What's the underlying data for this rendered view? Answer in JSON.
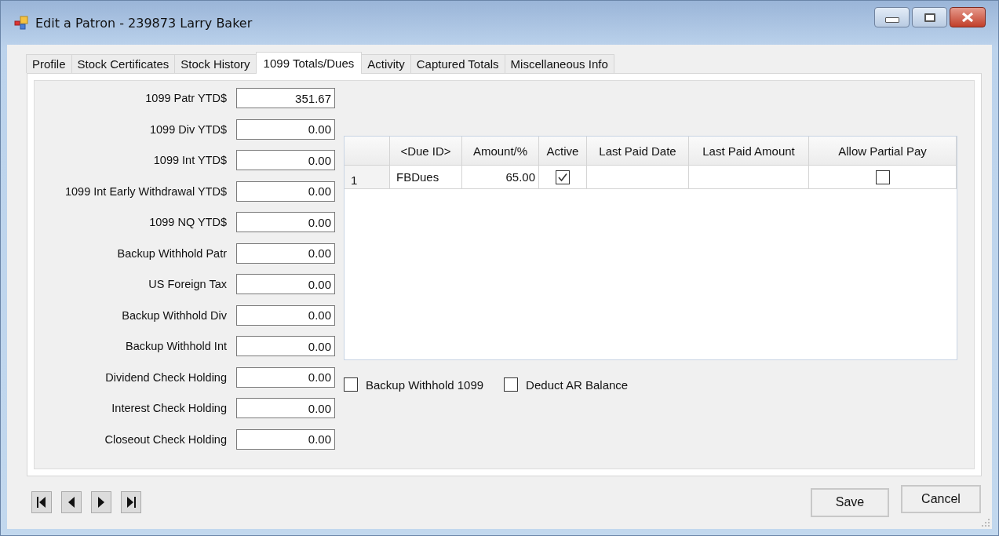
{
  "window": {
    "title": "Edit a Patron - 239873 Larry Baker"
  },
  "tabs": [
    {
      "label": "Profile",
      "selected": false
    },
    {
      "label": "Stock Certificates",
      "selected": false
    },
    {
      "label": "Stock History",
      "selected": false
    },
    {
      "label": "1099 Totals/Dues",
      "selected": true
    },
    {
      "label": "Activity",
      "selected": false
    },
    {
      "label": "Captured Totals",
      "selected": false
    },
    {
      "label": "Miscellaneous Info",
      "selected": false
    }
  ],
  "fields": [
    {
      "label": "1099 Patr YTD$",
      "value": "351.67"
    },
    {
      "label": "1099 Div YTD$",
      "value": "0.00"
    },
    {
      "label": "1099 Int YTD$",
      "value": "0.00"
    },
    {
      "label": "1099 Int Early Withdrawal YTD$",
      "value": "0.00"
    },
    {
      "label": "1099 NQ YTD$",
      "value": "0.00"
    },
    {
      "label": "Backup Withhold Patr",
      "value": "0.00"
    },
    {
      "label": "US Foreign Tax",
      "value": "0.00"
    },
    {
      "label": "Backup Withhold Div",
      "value": "0.00"
    },
    {
      "label": "Backup Withhold Int",
      "value": "0.00"
    },
    {
      "label": "Dividend Check Holding",
      "value": "0.00"
    },
    {
      "label": "Interest Check Holding",
      "value": "0.00"
    },
    {
      "label": "Closeout Check Holding",
      "value": "0.00"
    }
  ],
  "dues_table": {
    "columns": [
      "<Due ID>",
      "Amount/%",
      "Active",
      "Last Paid Date",
      "Last Paid Amount",
      "Allow Partial Pay"
    ],
    "rows": [
      {
        "row_number": "1",
        "due_id": "FBDues",
        "amount": "65.00",
        "active": true,
        "allow_partial_pay": false
      }
    ]
  },
  "options": [
    {
      "label": "Backup Withhold 1099",
      "checked": false
    },
    {
      "label": "Deduct AR Balance",
      "checked": false
    }
  ],
  "buttons": [
    "Save",
    "Cancel"
  ]
}
